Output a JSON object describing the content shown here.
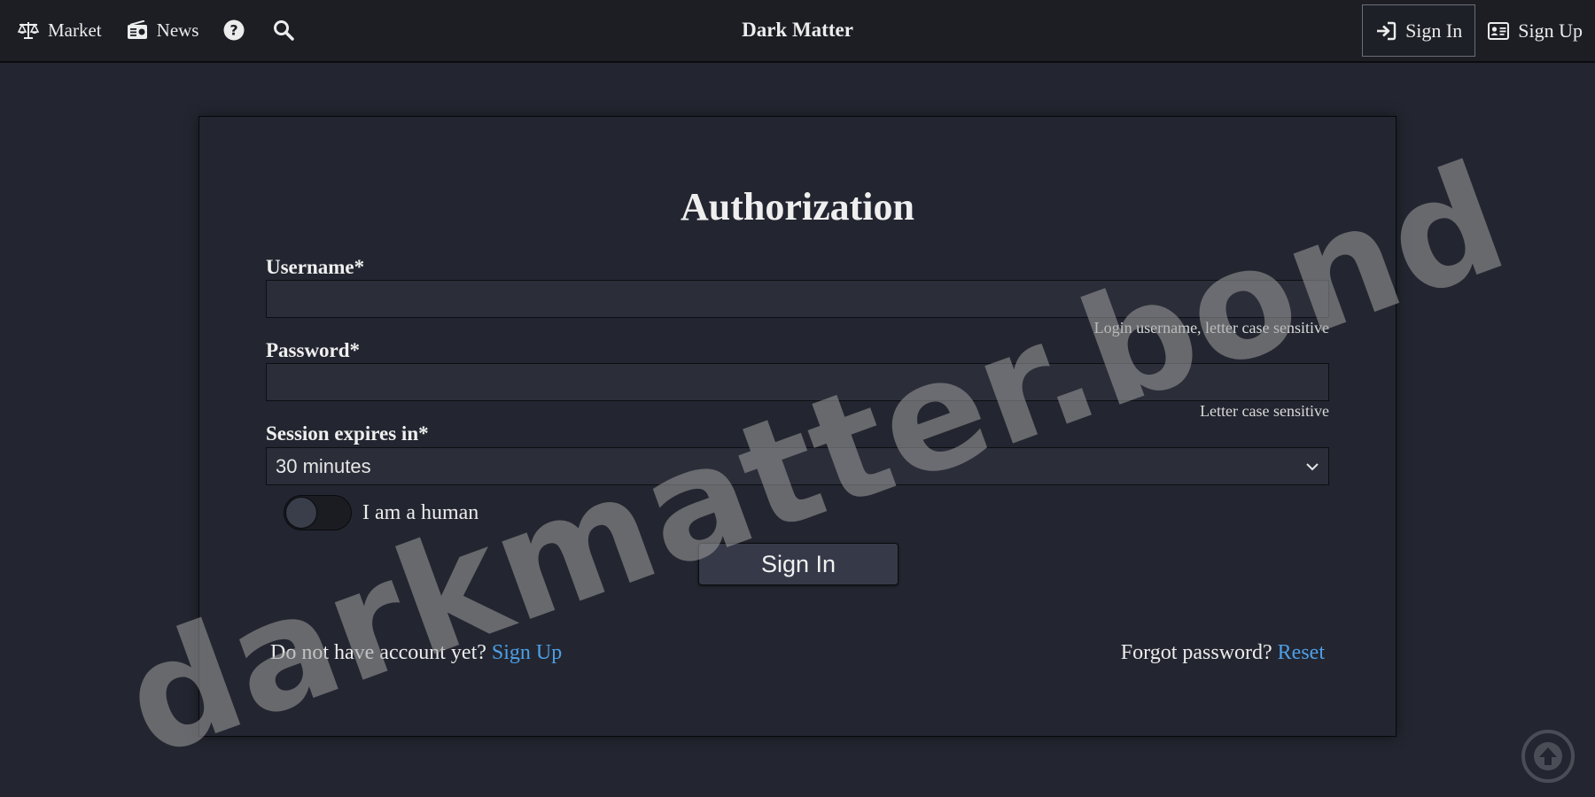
{
  "nav": {
    "market_label": "Market",
    "news_label": "News",
    "brand": "Dark Matter",
    "sign_in_label": "Sign In",
    "sign_up_label": "Sign Up"
  },
  "form": {
    "title": "Authorization",
    "username_label": "Username*",
    "username_value": "",
    "username_hint": "Login username, letter case sensitive",
    "password_label": "Password*",
    "password_value": "",
    "password_hint": "Letter case sensitive",
    "session_label": "Session expires in*",
    "session_selected": "30 minutes",
    "human_toggle_label": "I am a human",
    "human_toggle_on": false,
    "submit_label": "Sign In",
    "no_account_text": "Do not have account yet?",
    "signup_link": "Sign Up",
    "forgot_text": "Forgot password?",
    "reset_link": "Reset"
  },
  "watermark": "darkmatter.bond",
  "colors": {
    "background": "#232630",
    "navbar": "#1c1e24",
    "link": "#4d9fe8"
  }
}
